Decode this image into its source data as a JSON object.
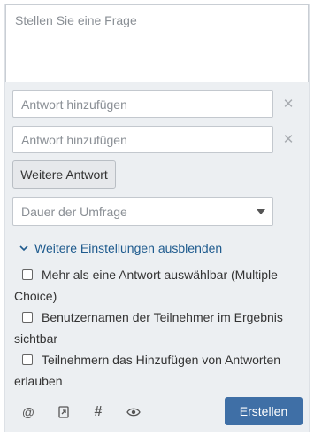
{
  "question": {
    "placeholder": "Stellen Sie eine Frage"
  },
  "answers": [
    {
      "placeholder": "Antwort hinzufügen",
      "remove_icon": "close-icon"
    },
    {
      "placeholder": "Antwort hinzufügen",
      "remove_icon": "close-icon"
    }
  ],
  "more_answer_button": "Weitere Antwort",
  "duration_select": {
    "placeholder": "Dauer der Umfrage",
    "icon": "caret-down-icon"
  },
  "settings_toggle": {
    "label": "Weitere Einstellungen ausblenden",
    "icon": "chevron-down-icon"
  },
  "options": [
    {
      "label": "Mehr als eine Antwort auswählbar (Multiple Choice)",
      "checked": false
    },
    {
      "label": "Benutzernamen der Teilnehmer im Ergebnis sichtbar",
      "checked": false
    },
    {
      "label": "Teilnehmern das Hinzufügen von Antworten erlauben",
      "checked": false
    }
  ],
  "toolbar": {
    "mention": "@",
    "hashtag": "#",
    "icons": [
      "at-icon",
      "link-icon",
      "hashtag-icon",
      "eye-icon"
    ],
    "submit_label": "Erstellen"
  },
  "colors": {
    "accent": "#3f6fa6",
    "link": "#1f5b8e",
    "panel": "#eceff2"
  }
}
